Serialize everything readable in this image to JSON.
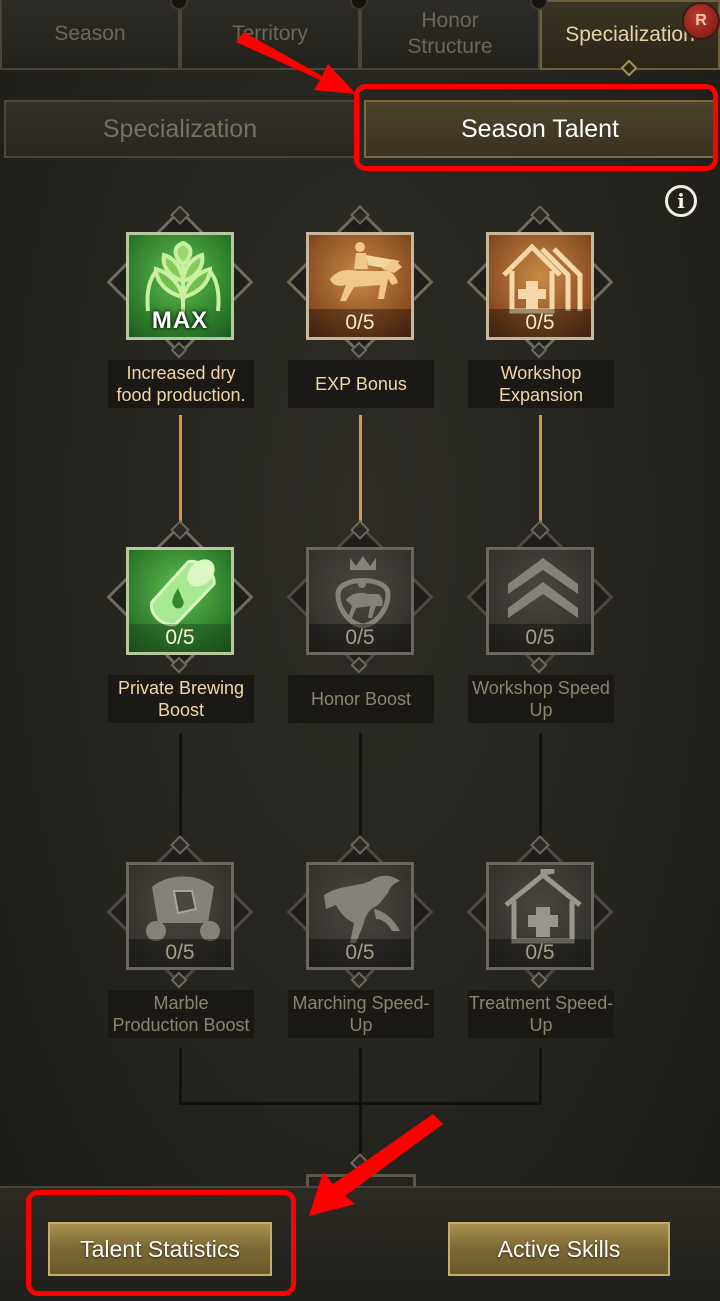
{
  "top_tabs": [
    {
      "label": "Season",
      "active": false
    },
    {
      "label": "Territory",
      "active": false
    },
    {
      "label": "Honor Structure",
      "active": false
    },
    {
      "label": "Specialization",
      "active": true
    }
  ],
  "badge_label": "R",
  "sub_tabs": {
    "specialization": "Specialization",
    "season_talent": "Season Talent"
  },
  "info_glyph": "i",
  "talents": [
    {
      "name": "Increased dry food production.",
      "level": "MAX",
      "state": "max",
      "icon": "wheat-icon"
    },
    {
      "name": "EXP Bonus",
      "level": "0/5",
      "state": "available",
      "icon": "knight-on-horse-icon"
    },
    {
      "name": "Workshop Expansion",
      "level": "0/5",
      "state": "available",
      "icon": "workshop-buildings-icon"
    },
    {
      "name": "Private Brewing Boost",
      "level": "0/5",
      "state": "unlocked",
      "icon": "barrel-drop-icon"
    },
    {
      "name": "Honor Boost",
      "level": "0/5",
      "state": "locked",
      "icon": "crowned-knight-icon"
    },
    {
      "name": "Workshop Speed Up",
      "level": "0/5",
      "state": "locked",
      "icon": "chevrons-up-icon"
    },
    {
      "name": "Marble Production Boost",
      "level": "0/5",
      "state": "locked",
      "icon": "marble-cart-icon"
    },
    {
      "name": "Marching Speed-Up",
      "level": "0/5",
      "state": "locked",
      "icon": "galloping-horse-icon"
    },
    {
      "name": "Treatment Speed-Up",
      "level": "0/5",
      "state": "locked",
      "icon": "hospital-icon"
    }
  ],
  "buttons": {
    "talent_statistics": "Talent Statistics",
    "active_skills": "Active Skills"
  },
  "colors": {
    "highlight": "#ff0000",
    "connector_active": "#d39b3e",
    "label_lit": "#f3d6a6"
  }
}
